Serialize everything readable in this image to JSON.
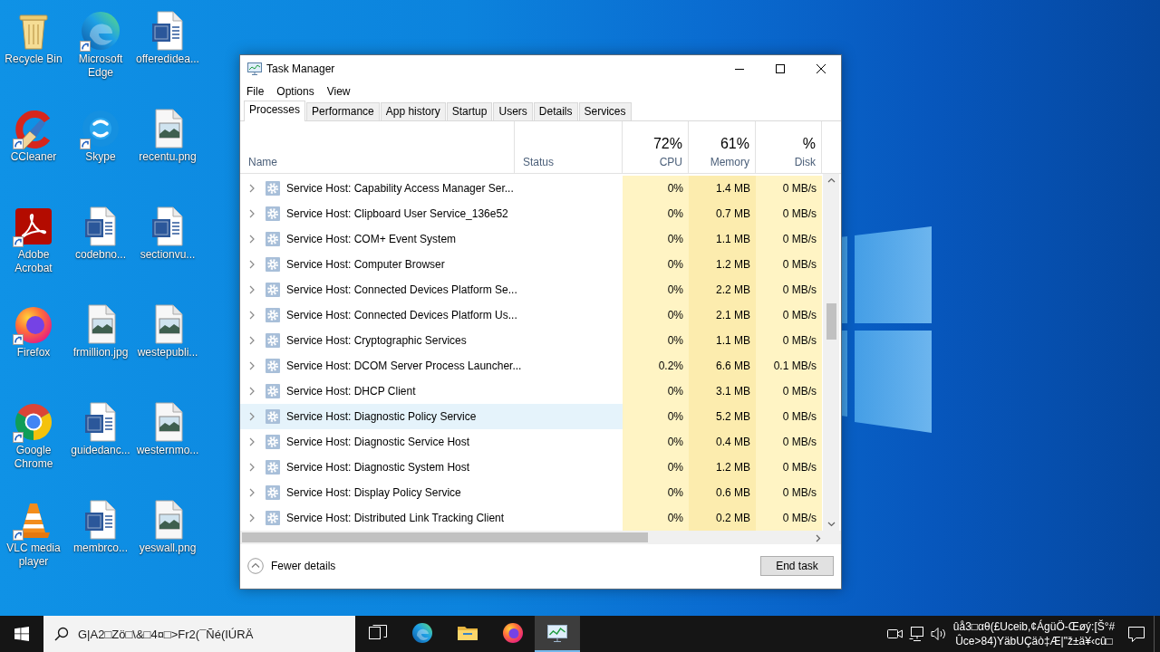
{
  "desktop": {
    "icons": [
      {
        "label": "Recycle Bin",
        "kind": "recycle-bin",
        "shortcut": false
      },
      {
        "label": "Microsoft Edge",
        "kind": "edge",
        "shortcut": true
      },
      {
        "label": "offeredidea...",
        "kind": "word",
        "shortcut": false
      },
      {
        "label": "CCleaner",
        "kind": "ccleaner",
        "shortcut": true
      },
      {
        "label": "Skype",
        "kind": "skype",
        "shortcut": true
      },
      {
        "label": "recentu.png",
        "kind": "image",
        "shortcut": false
      },
      {
        "label": "Adobe Acrobat",
        "kind": "acrobat",
        "shortcut": true
      },
      {
        "label": "codebno...",
        "kind": "word",
        "shortcut": false
      },
      {
        "label": "sectionvu...",
        "kind": "word",
        "shortcut": false
      },
      {
        "label": "Firefox",
        "kind": "firefox",
        "shortcut": true
      },
      {
        "label": "frmillion.jpg",
        "kind": "image",
        "shortcut": false
      },
      {
        "label": "westepubli...",
        "kind": "image",
        "shortcut": false
      },
      {
        "label": "Google Chrome",
        "kind": "chrome",
        "shortcut": true
      },
      {
        "label": "guidedanc...",
        "kind": "word",
        "shortcut": false
      },
      {
        "label": "westernmo...",
        "kind": "image",
        "shortcut": false
      },
      {
        "label": "VLC media player",
        "kind": "vlc",
        "shortcut": true
      },
      {
        "label": "membrco...",
        "kind": "word",
        "shortcut": false
      },
      {
        "label": "yeswall.png",
        "kind": "image",
        "shortcut": false
      }
    ]
  },
  "task_manager": {
    "title": "Task Manager",
    "menu": [
      "File",
      "Options",
      "View"
    ],
    "tabs": [
      {
        "label": "Processes",
        "selected": true
      },
      {
        "label": "Performance",
        "selected": false
      },
      {
        "label": "App history",
        "selected": false
      },
      {
        "label": "Startup",
        "selected": false
      },
      {
        "label": "Users",
        "selected": false
      },
      {
        "label": "Details",
        "selected": false
      },
      {
        "label": "Services",
        "selected": false
      }
    ],
    "columns": [
      {
        "label": "Name"
      },
      {
        "label": "Status"
      },
      {
        "usage": "72%",
        "label": "CPU"
      },
      {
        "usage": "61%",
        "label": "Memory"
      },
      {
        "usage": "%",
        "label": "Disk"
      }
    ],
    "rows": [
      {
        "name": "Service Host: Capability Access Manager Ser...",
        "cpu": "0%",
        "memory": "1.4 MB",
        "disk": "0 MB/s",
        "selected": false
      },
      {
        "name": "Service Host: Clipboard User Service_136e52",
        "cpu": "0%",
        "memory": "0.7 MB",
        "disk": "0 MB/s",
        "selected": false
      },
      {
        "name": "Service Host: COM+ Event System",
        "cpu": "0%",
        "memory": "1.1 MB",
        "disk": "0 MB/s",
        "selected": false
      },
      {
        "name": "Service Host: Computer Browser",
        "cpu": "0%",
        "memory": "1.2 MB",
        "disk": "0 MB/s",
        "selected": false
      },
      {
        "name": "Service Host: Connected Devices Platform Se...",
        "cpu": "0%",
        "memory": "2.2 MB",
        "disk": "0 MB/s",
        "selected": false
      },
      {
        "name": "Service Host: Connected Devices Platform Us...",
        "cpu": "0%",
        "memory": "2.1 MB",
        "disk": "0 MB/s",
        "selected": false
      },
      {
        "name": "Service Host: Cryptographic Services",
        "cpu": "0%",
        "memory": "1.1 MB",
        "disk": "0 MB/s",
        "selected": false
      },
      {
        "name": "Service Host: DCOM Server Process Launcher...",
        "cpu": "0.2%",
        "memory": "6.6 MB",
        "disk": "0.1 MB/s",
        "selected": false
      },
      {
        "name": "Service Host: DHCP Client",
        "cpu": "0%",
        "memory": "3.1 MB",
        "disk": "0 MB/s",
        "selected": false
      },
      {
        "name": "Service Host: Diagnostic Policy Service",
        "cpu": "0%",
        "memory": "5.2 MB",
        "disk": "0 MB/s",
        "selected": true
      },
      {
        "name": "Service Host: Diagnostic Service Host",
        "cpu": "0%",
        "memory": "0.4 MB",
        "disk": "0 MB/s",
        "selected": false
      },
      {
        "name": "Service Host: Diagnostic System Host",
        "cpu": "0%",
        "memory": "1.2 MB",
        "disk": "0 MB/s",
        "selected": false
      },
      {
        "name": "Service Host: Display Policy Service",
        "cpu": "0%",
        "memory": "0.6 MB",
        "disk": "0 MB/s",
        "selected": false
      },
      {
        "name": "Service Host: Distributed Link Tracking Client",
        "cpu": "0%",
        "memory": "0.2 MB",
        "disk": "0 MB/s",
        "selected": false
      }
    ],
    "footer": {
      "toggle": "Fewer details",
      "button": "End task"
    }
  },
  "taskbar": {
    "search": {
      "placeholder": "G|A2□Zö□\\&□4¤□>Fr2(¯Ñé(IÚRÄ"
    },
    "apps": [
      {
        "kind": "task-view",
        "active": false
      },
      {
        "kind": "edge",
        "active": false
      },
      {
        "kind": "explorer",
        "active": false
      },
      {
        "kind": "firefox",
        "active": false
      },
      {
        "kind": "task-manager",
        "active": true
      }
    ],
    "clock": [
      "ûå3□αθ(£Uceib,¢ÁgüÖ-Œøý:[Š°#",
      "Ûce>84)YäbUÇäò‡Æ|\"ž±ä¥‹cû□"
    ]
  }
}
